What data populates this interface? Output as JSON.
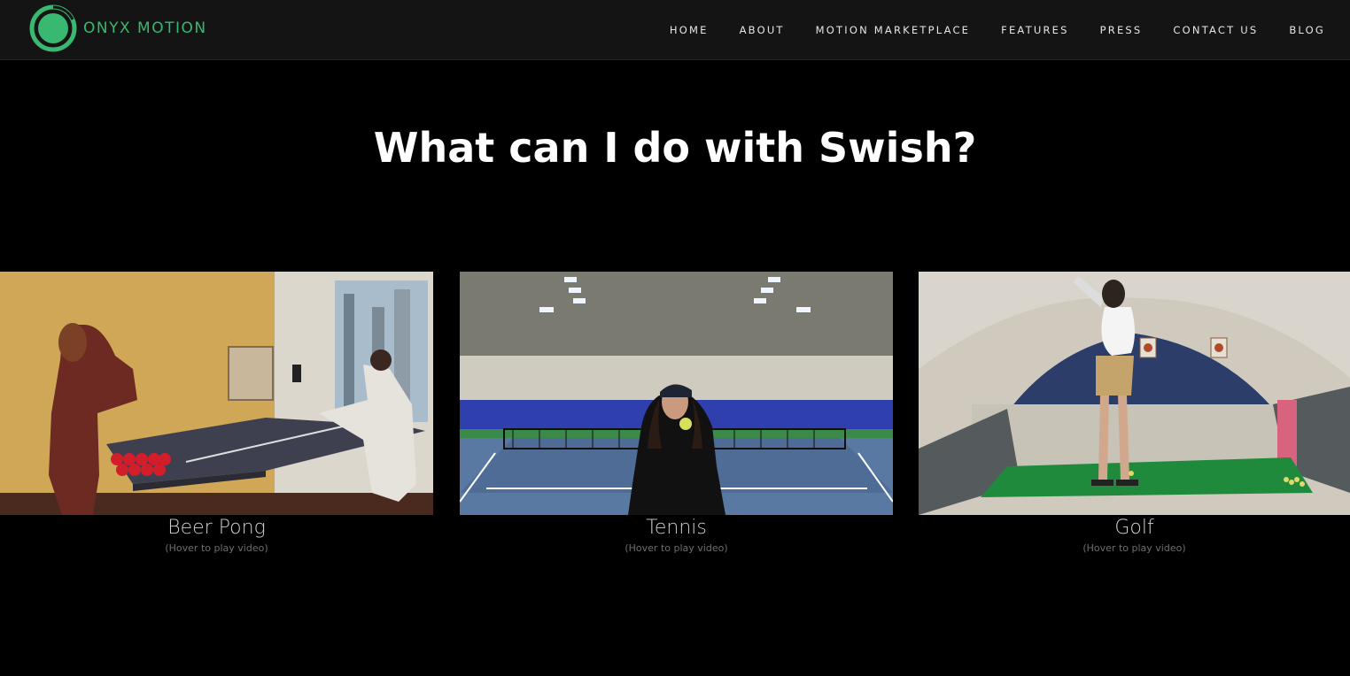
{
  "brand": {
    "name": "ONYX MOTION",
    "color": "#38b870"
  },
  "nav": {
    "items": [
      {
        "label": "HOME"
      },
      {
        "label": "ABOUT"
      },
      {
        "label": "MOTION MARKETPLACE"
      },
      {
        "label": "FEATURES"
      },
      {
        "label": "PRESS"
      },
      {
        "label": "CONTACT US"
      },
      {
        "label": "BLOG"
      }
    ]
  },
  "main": {
    "heading": "What can I do with Swish?",
    "cards": [
      {
        "title": "Beer Pong",
        "hint": "(Hover to play video)"
      },
      {
        "title": "Tennis",
        "hint": "(Hover to play video)"
      },
      {
        "title": "Golf",
        "hint": "(Hover to play video)"
      }
    ]
  }
}
